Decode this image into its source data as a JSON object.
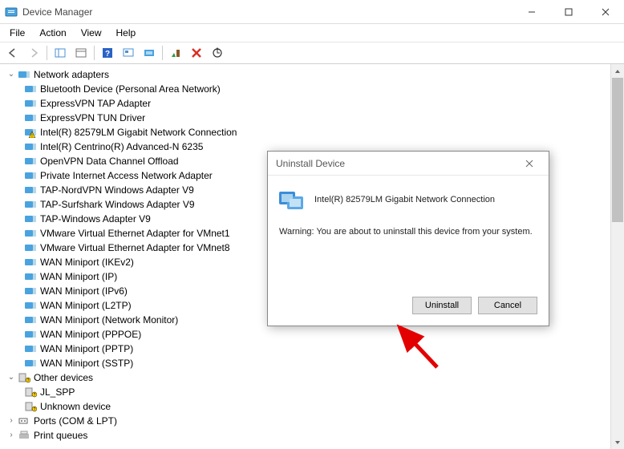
{
  "window": {
    "title": "Device Manager",
    "controls": {
      "minimize": "—",
      "maximize": "☐",
      "close": "✕"
    }
  },
  "menu": {
    "file": "File",
    "action": "Action",
    "view": "View",
    "help": "Help"
  },
  "toolbar": {
    "back": "back",
    "forward": "forward",
    "show": "show",
    "props": "properties",
    "help": "help",
    "console": "show-hidden",
    "monitor": "display",
    "refresh": "refresh",
    "delete": "delete",
    "upsearch": "scan"
  },
  "tree": {
    "network_adapters": {
      "label": "Network adapters",
      "items": [
        "Bluetooth Device (Personal Area Network)",
        "ExpressVPN TAP Adapter",
        "ExpressVPN TUN Driver",
        "Intel(R) 82579LM Gigabit Network Connection",
        "Intel(R) Centrino(R) Advanced-N 6235",
        "OpenVPN Data Channel Offload",
        "Private Internet Access Network Adapter",
        "TAP-NordVPN Windows Adapter V9",
        "TAP-Surfshark Windows Adapter V9",
        "TAP-Windows Adapter V9",
        "VMware Virtual Ethernet Adapter for VMnet1",
        "VMware Virtual Ethernet Adapter for VMnet8",
        "WAN Miniport (IKEv2)",
        "WAN Miniport (IP)",
        "WAN Miniport (IPv6)",
        "WAN Miniport (L2TP)",
        "WAN Miniport (Network Monitor)",
        "WAN Miniport (PPPOE)",
        "WAN Miniport (PPTP)",
        "WAN Miniport (SSTP)"
      ]
    },
    "other_devices": {
      "label": "Other devices",
      "items": [
        "JL_SPP",
        "Unknown device"
      ]
    },
    "ports": {
      "label": "Ports (COM & LPT)"
    },
    "print_queues": {
      "label": "Print queues"
    }
  },
  "dialog": {
    "title": "Uninstall Device",
    "device": "Intel(R) 82579LM Gigabit Network Connection",
    "warning": "Warning: You are about to uninstall this device from your system.",
    "uninstall": "Uninstall",
    "cancel": "Cancel"
  }
}
